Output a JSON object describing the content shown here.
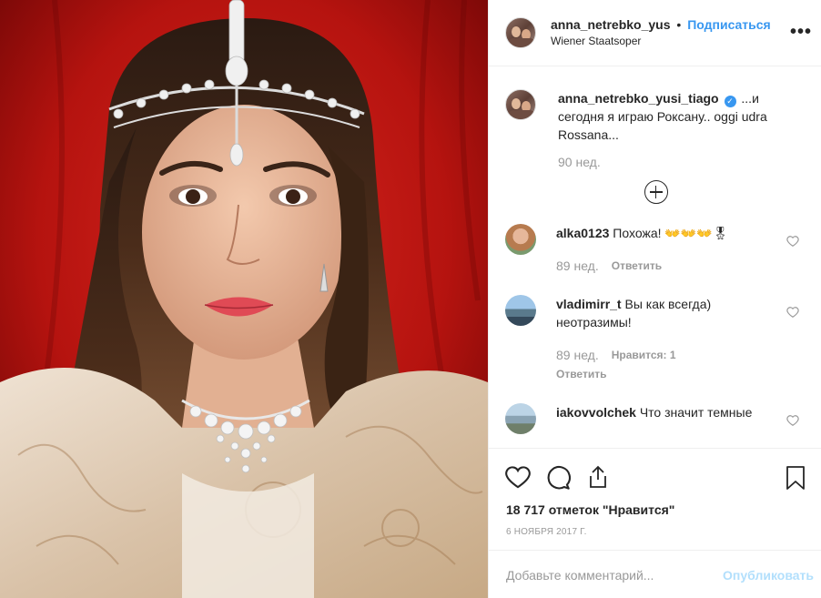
{
  "post": {
    "photo_icon": "portrait-photo",
    "header": {
      "username": "anna_netrebko_yus",
      "separator": "•",
      "follow_label": "Подписаться",
      "location": "Wiener Staatsoper",
      "more_icon": "ellipsis-icon",
      "more_label": "•••"
    },
    "caption": {
      "username": "anna_netrebko_yusi_tiago",
      "verified_mark": "✓",
      "text": "...и сегодня я играю Роксану.. oggi udra Rossana...",
      "time": "90 нед."
    },
    "load_more_icon": "plus-circle-icon",
    "comments": [
      {
        "username": "alka0123",
        "text": "Похожа! 👐👐👐🎖",
        "time": "89 нед.",
        "reply_label": "Ответить"
      },
      {
        "username": "vladimirr_t",
        "text": "Вы как всегда) неотразимы!",
        "time": "89 нед.",
        "likes_label": "Нравится: 1",
        "reply_label": "Ответить"
      },
      {
        "username": "iakovvolchek",
        "text": "Что значит темные",
        "time": "",
        "reply_label": ""
      }
    ],
    "actions": {
      "like_icon": "heart-icon",
      "comment_icon": "comment-icon",
      "share_icon": "share-icon",
      "save_icon": "bookmark-icon"
    },
    "likes_text": "18 717 отметок \"Нравится\"",
    "date": "6 НОЯБРЯ 2017 Г.",
    "add_comment": {
      "placeholder": "Добавьте комментарий...",
      "publish_label": "Опубликовать"
    },
    "colors": {
      "accent": "#3897f0",
      "publish_disabled": "#b2dffc",
      "muted": "#999999",
      "text": "#262626",
      "background_red": "#c91a1a"
    }
  }
}
